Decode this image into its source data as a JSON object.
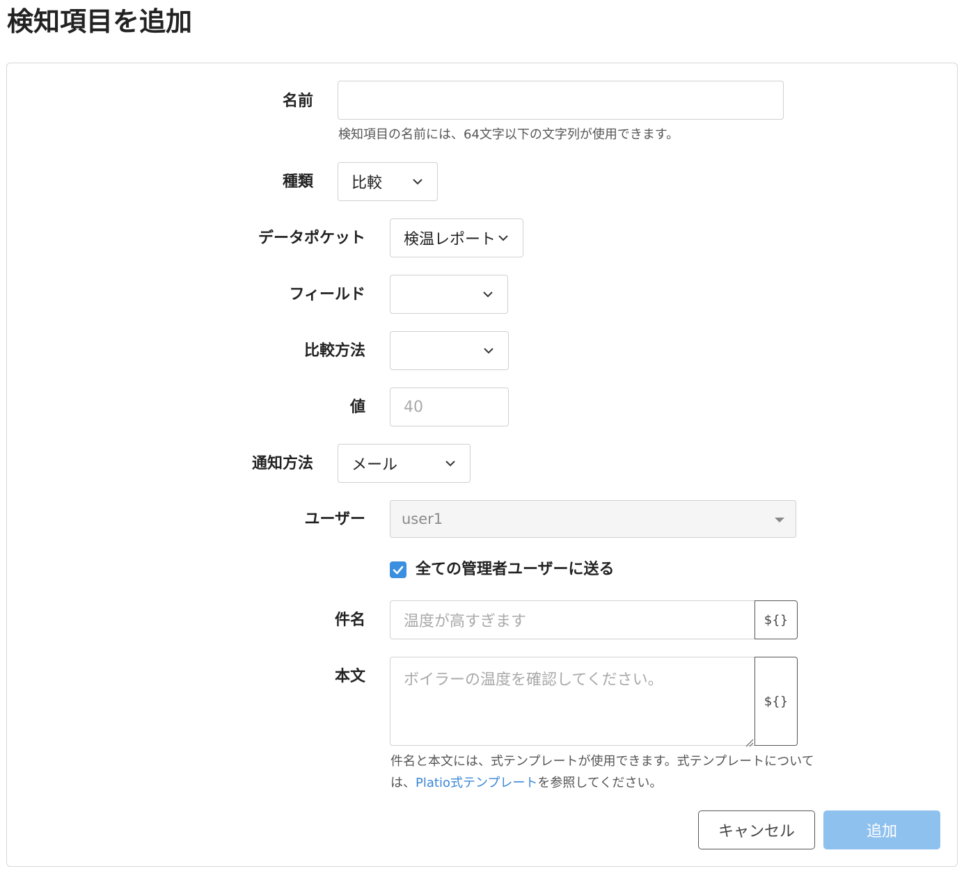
{
  "page": {
    "title": "検知項目を追加"
  },
  "form": {
    "name": {
      "label": "名前",
      "value": "",
      "hint": "検知項目の名前には、64文字以下の文字列が使用できます。"
    },
    "type": {
      "label": "種類",
      "value": "比較"
    },
    "datapocket": {
      "label": "データポケット",
      "value": "検温レポート"
    },
    "field": {
      "label": "フィールド",
      "value": ""
    },
    "method": {
      "label": "比較方法",
      "value": ""
    },
    "value": {
      "label": "値",
      "placeholder": "40"
    },
    "notify": {
      "label": "通知方法",
      "value": "メール"
    },
    "user": {
      "label": "ユーザー",
      "value": "user1"
    },
    "send_all": {
      "label": "全ての管理者ユーザーに送る",
      "checked": true
    },
    "subject": {
      "label": "件名",
      "placeholder": "温度が高すぎます",
      "addon": "${}"
    },
    "body": {
      "label": "本文",
      "placeholder": "ボイラーの温度を確認してください。",
      "addon": "${}"
    },
    "template_hint": {
      "line1": "件名と本文には、式テンプレートが使用できます。式テンプレートについて",
      "line2_prefix": "は、",
      "link": "Platio式テンプレート",
      "line2_suffix": "を参照してください。"
    }
  },
  "actions": {
    "cancel": "キャンセル",
    "submit": "追加"
  },
  "colors": {
    "accent": "#3b8fe0",
    "primary_disabled": "#8fc1ee",
    "link": "#3a86d6"
  },
  "icons": {
    "chevron": "chevron-down-icon",
    "check": "check-icon",
    "caret": "caret-down-icon"
  }
}
